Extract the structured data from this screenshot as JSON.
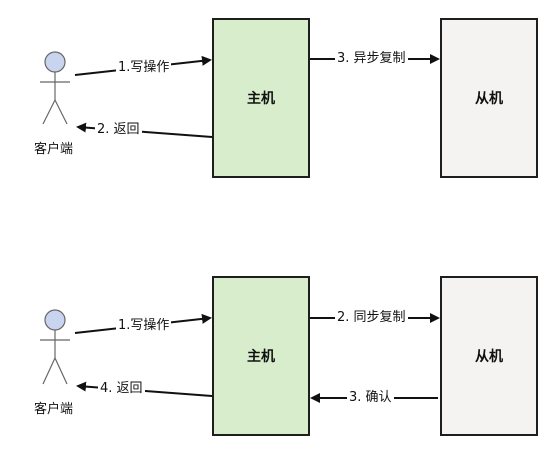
{
  "diagrams": [
    {
      "client_label": "客户端",
      "master_label": "主机",
      "slave_label": "从机",
      "arrows": {
        "write": "1.写操作",
        "return": "2. 返回",
        "replicate": "3. 异步复制"
      }
    },
    {
      "client_label": "客户端",
      "master_label": "主机",
      "slave_label": "从机",
      "arrows": {
        "write": "1.写操作",
        "replicate": "2. 同步复制",
        "confirm": "3. 确认",
        "return": "4. 返回"
      }
    }
  ],
  "colors": {
    "master_fill": "#d8edcc",
    "slave_fill": "#f4f3f1",
    "actor_head": "#c9d5ee",
    "line": "#111111"
  }
}
